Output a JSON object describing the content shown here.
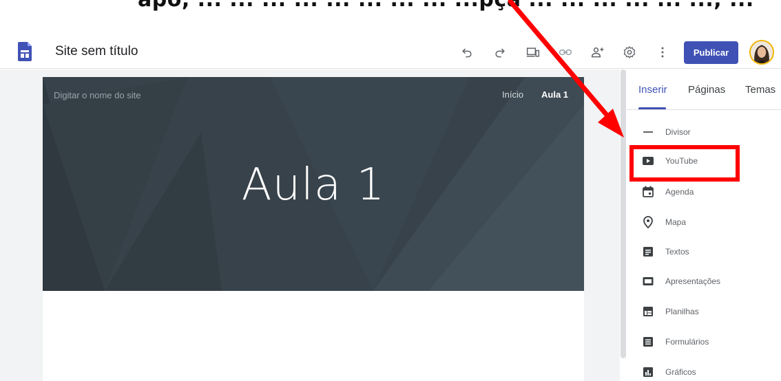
{
  "caption": {
    "text": "apó, ... ... ... ... ... ... ... ... ...pça ... ... ... ... ... ..., ..."
  },
  "topbar": {
    "title": "Site sem título",
    "publish_label": "Publicar",
    "icons": [
      "undo-icon",
      "redo-icon",
      "preview-icon",
      "link-icon",
      "share-icon",
      "settings-icon",
      "more-icon"
    ]
  },
  "hero": {
    "site_name_placeholder": "Digitar o nome do site",
    "nav": [
      "Início",
      "Aula 1"
    ],
    "title": "Aula 1"
  },
  "panel": {
    "tabs": [
      "Inserir",
      "Páginas",
      "Temas"
    ],
    "items": [
      {
        "label": "Divisor",
        "icon": "divider-icon"
      },
      {
        "label": "YouTube",
        "icon": "youtube-icon"
      },
      {
        "label": "Agenda",
        "icon": "calendar-icon"
      },
      {
        "label": "Mapa",
        "icon": "map-pin-icon"
      },
      {
        "label": "Textos",
        "icon": "docs-icon"
      },
      {
        "label": "Apresentações",
        "icon": "slides-icon"
      },
      {
        "label": "Planilhas",
        "icon": "sheets-icon"
      },
      {
        "label": "Formulários",
        "icon": "forms-icon"
      },
      {
        "label": "Gráficos",
        "icon": "charts-icon"
      }
    ]
  },
  "colors": {
    "accent": "#3f51b5",
    "hero_bg": "#37424b",
    "annotation": "#ff0000"
  }
}
